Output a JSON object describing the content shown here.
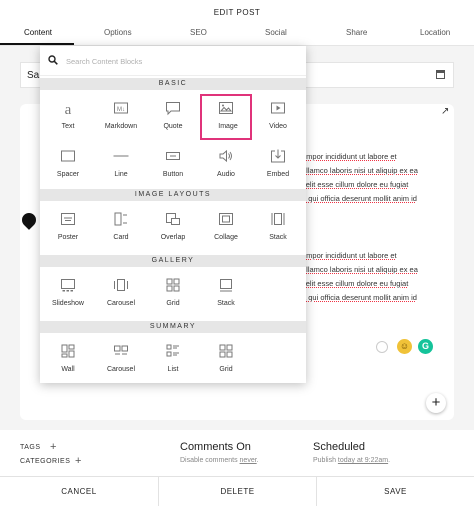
{
  "header": {
    "title": "EDIT POST",
    "tabs": [
      {
        "label": "Content",
        "active": true
      },
      {
        "label": "Options"
      },
      {
        "label": "SEO"
      },
      {
        "label": "Social"
      },
      {
        "label": "Share"
      },
      {
        "label": "Location"
      }
    ]
  },
  "editor": {
    "title_value": "Sa",
    "paragraph1": [
      "empor incididunt ut labore et",
      "ullamco laboris nisi ut aliquip ex ea",
      "velit esse cillum dolore eu fugiat",
      "a qui officia deserunt mollit anim id"
    ],
    "paragraph2": [
      "empor incididunt ut labore et",
      "ullamco laboris nisi ut aliquip ex ea",
      "velit esse cillum dolore eu fugiat",
      "a qui officia deserunt mollit anim id"
    ],
    "add_glyph": "+"
  },
  "block_picker": {
    "search_placeholder": "Search Content Blocks",
    "sections": {
      "basic": {
        "title": "BASIC",
        "blocks": [
          "Text",
          "Markdown",
          "Quote",
          "Image",
          "Video",
          "Spacer",
          "Line",
          "Button",
          "Audio",
          "Embed"
        ],
        "highlighted": "Image"
      },
      "image_layouts": {
        "title": "IMAGE LAYOUTS",
        "blocks": [
          "Poster",
          "Card",
          "Overlap",
          "Collage",
          "Stack"
        ]
      },
      "gallery": {
        "title": "GALLERY",
        "blocks": [
          "Slideshow",
          "Carousel",
          "Grid",
          "Stack"
        ]
      },
      "summary": {
        "title": "SUMMARY",
        "blocks": [
          "Wall",
          "Carousel",
          "List",
          "Grid"
        ]
      }
    }
  },
  "meta": {
    "tags_label": "TAGS",
    "categories_label": "CATEGORIES",
    "comments": {
      "heading": "Comments On",
      "sub_prefix": "Disable comments ",
      "sub_link": "never",
      "sub_suffix": "."
    },
    "schedule": {
      "heading": "Scheduled",
      "sub_prefix": "Publish ",
      "sub_link": "today at 9:22am",
      "sub_suffix": "."
    }
  },
  "footer": {
    "cancel": "CANCEL",
    "delete": "DELETE",
    "save": "SAVE"
  },
  "colors": {
    "highlight": "#e0337a",
    "section_bg": "#e6e6e6",
    "grammarly": "#15c39a"
  }
}
